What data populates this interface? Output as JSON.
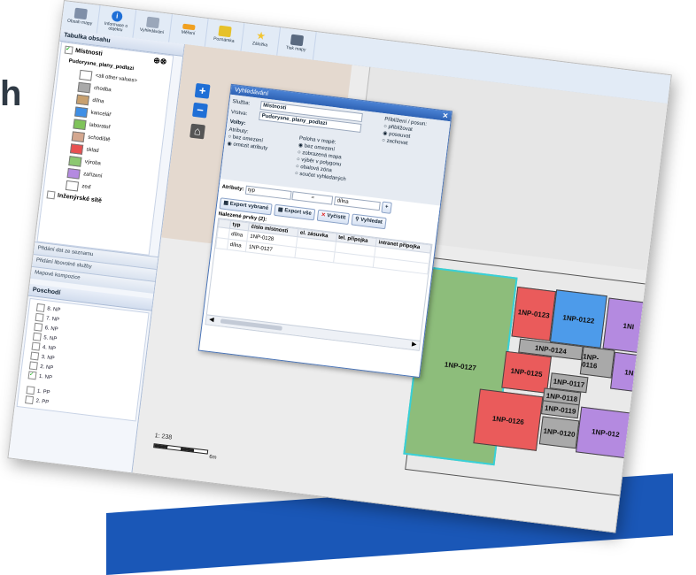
{
  "side_text": "h",
  "toolbar": {
    "buttons": [
      {
        "label": "Obsah mapy",
        "icon": "layers-icon",
        "color": "#7f8fa8"
      },
      {
        "label": "Informace o objektu",
        "icon": "info-icon",
        "color": "#1f6fd6"
      },
      {
        "label": "Vyhledávání",
        "icon": "search-icon",
        "color": "#9aa7ba"
      },
      {
        "label": "Měření",
        "icon": "measure-icon",
        "color": "#f0a020"
      },
      {
        "label": "Poznámka",
        "icon": "note-icon",
        "color": "#e6c12a"
      },
      {
        "label": "Záložka",
        "icon": "bookmark-star-icon",
        "color": "#f2c531"
      },
      {
        "label": "Tisk mapy",
        "icon": "printer-icon",
        "color": "#5a6a80"
      }
    ]
  },
  "left_panel": {
    "title": "Tabulka obsahu",
    "layer_group": "Místnosti",
    "sublayer": "Pudorysne_plany_podlazi",
    "legend": [
      {
        "label": "<all other values>",
        "color": "#ffffff"
      },
      {
        "label": "chodba",
        "color": "#a9a9a9"
      },
      {
        "label": "dílna",
        "color": "#c8a06e"
      },
      {
        "label": "kancelář",
        "color": "#3e8fe6"
      },
      {
        "label": "laboratoř",
        "color": "#7fc35a"
      },
      {
        "label": "schodiště",
        "color": "#d4a78f"
      },
      {
        "label": "sklad",
        "color": "#e85050"
      },
      {
        "label": "výroba",
        "color": "#8cc870"
      },
      {
        "label": "zařízení",
        "color": "#b48ae0"
      },
      {
        "label": "zeď",
        "color": "#ffffff"
      }
    ],
    "other_layer": "Inženýrské sítě",
    "accordions": [
      "Přidání dat ze seznamu",
      "Přidání libovolné služby",
      "Mapové kompozice"
    ],
    "floors_title": "Poschodí",
    "floors": [
      {
        "label": "8. NP",
        "checked": false
      },
      {
        "label": "7. NP",
        "checked": false
      },
      {
        "label": "6. NP",
        "checked": false
      },
      {
        "label": "5. NP",
        "checked": false
      },
      {
        "label": "4. NP",
        "checked": false
      },
      {
        "label": "3. NP",
        "checked": false
      },
      {
        "label": "2. NP",
        "checked": false
      },
      {
        "label": "1. NP",
        "checked": true
      }
    ],
    "basements": [
      {
        "label": "1. PP",
        "checked": false
      },
      {
        "label": "2. PP",
        "checked": false
      }
    ]
  },
  "map": {
    "scale_text": "1: 238",
    "scale_unit": "6m",
    "rooms": [
      {
        "label": "1NP-0127",
        "color": "#8dbd7b"
      },
      {
        "label": "1NP-0123",
        "color": "#ea5b5b"
      },
      {
        "label": "1NP-0122",
        "color": "#4d9bea"
      },
      {
        "label": "1NP-0124",
        "color": "#a9a9a9"
      },
      {
        "label": "1NP-0116",
        "color": "#a9a9a9"
      },
      {
        "label": "1NP-0125",
        "color": "#ea5b5b"
      },
      {
        "label": "1NP-0117",
        "color": "#a9a9a9"
      },
      {
        "label": "1NP-0118",
        "color": "#a9a9a9"
      },
      {
        "label": "1NP-0119",
        "color": "#a9a9a9"
      },
      {
        "label": "1NP-0126",
        "color": "#ea5b5b"
      },
      {
        "label": "1NP-0120",
        "color": "#a9a9a9"
      },
      {
        "label": "1NP-012",
        "color": "#b48ae0"
      },
      {
        "label": "1NI",
        "color": "#b48ae0"
      },
      {
        "label": "1N",
        "color": "#b48ae0"
      }
    ]
  },
  "search_dialog": {
    "title": "Vyhledávání",
    "service_label": "Služba:",
    "service_value": "Místnosti",
    "layer_label": "Vrstva:",
    "layer_value": "Pudorysne_plany_podlazi",
    "zoom_label": "Přiblížení / posun:",
    "zoom_options": [
      "přiblížovat",
      "posouvat",
      "zachovat"
    ],
    "options_label": "Volby:",
    "attr_label": "Atributy:",
    "attr_options": [
      "bez omezení",
      "omezit atributy"
    ],
    "pos_label": "Poloha v mapě:",
    "pos_options": [
      "bez omezení",
      "zobrazená mapa",
      "výběr v polygonu",
      "obalová zóna",
      "součet vyhledaných"
    ],
    "criteria_label": "Atributy:",
    "criteria_attr": "typ",
    "criteria_op": "=",
    "criteria_value": "dílna",
    "btn_export_selected": "Export vybrané",
    "btn_export_all": "Export vše",
    "btn_clear": "Vyčistit",
    "btn_search": "Vyhledat",
    "found_label": "Nalezené prvky (2):",
    "columns": [
      "typ",
      "číslo místnosti",
      "el. zásuvka",
      "tel. přípojka",
      "intranet přípojka"
    ],
    "rows": [
      {
        "typ": "dílna",
        "cislo": "1NP-0128"
      },
      {
        "typ": "dílna",
        "cislo": "1NP-0127"
      }
    ]
  }
}
